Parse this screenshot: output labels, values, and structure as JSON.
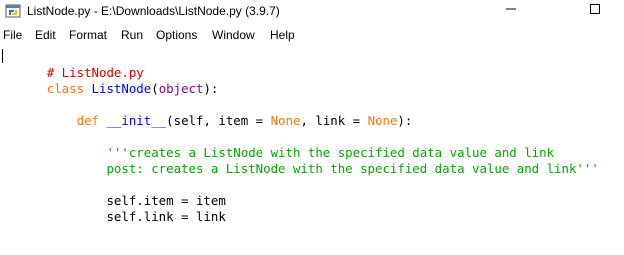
{
  "window": {
    "title": "ListNode.py - E:\\Downloads\\ListNode.py (3.9.7)",
    "icon": "python-idle-icon",
    "controls": [
      "minimize-icon",
      "maximize-icon"
    ]
  },
  "menu": {
    "items": [
      "File",
      "Edit",
      "Format",
      "Run",
      "Options",
      "Window",
      "Help"
    ]
  },
  "colors": {
    "comment": "#dd0000",
    "keyword": "#ff7700",
    "builtin": "#900090",
    "definition": "#0000ff",
    "string": "#00aa00",
    "text": "#000000"
  },
  "editor": {
    "line1": {
      "comment": "# ListNode.py"
    },
    "line2": {
      "kw": "class",
      "space": " ",
      "name": "ListNode",
      "open": "(",
      "builtin": "object",
      "close": "):"
    },
    "line4": {
      "indent": "    ",
      "kw": "def",
      "space": " ",
      "name": "__init__",
      "p1": "(self, item = ",
      "none1": "None",
      "p2": ", link = ",
      "none2": "None",
      "p3": "):"
    },
    "line6": {
      "indent": "        ",
      "text": "'''creates a ListNode with the specified data value and link"
    },
    "line7": {
      "indent": "        ",
      "text": "post: creates a ListNode with the specified data value and link'''"
    },
    "line9": {
      "indent": "        ",
      "text": "self.item = item"
    },
    "line10": {
      "indent": "        ",
      "text": "self.link = link"
    }
  }
}
